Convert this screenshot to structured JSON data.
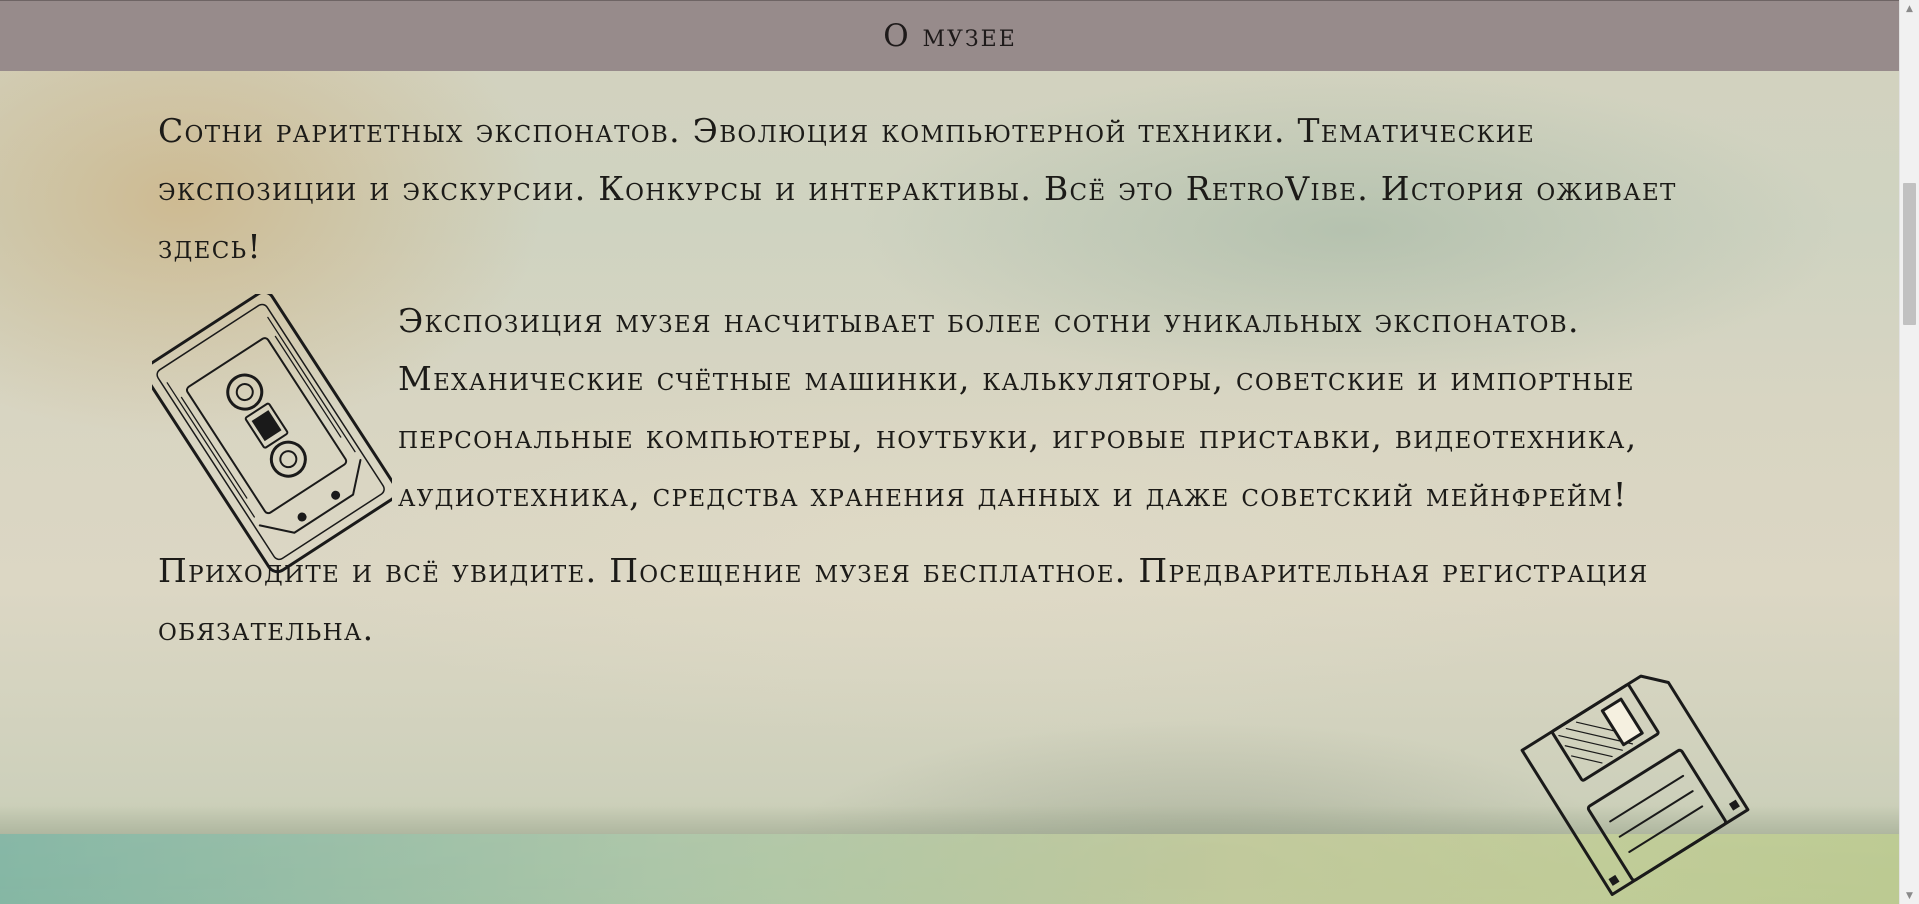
{
  "header": {
    "title": "О музее"
  },
  "content": {
    "intro": "Сотни раритетных экспонатов. Эволюция компьютерной техники. Тематические экспозиции и экскурсии. Конкурсы и интерактивы. Всё это RetroVibe. История оживает здесь!",
    "exhibition": "Экспозиция музея насчитывает более сотни уникальных экспонатов. Механические счётные машинки, калькуляторы, советские и импортные персональные компьютеры, ноутбуки, игровые приставки, видеотехника, аудиотехника, средства хранения данных и даже советский мейнфрейм!",
    "visit": "Приходите и всё увидите. Посещение музея бесплатное. Предварительная регистрация обязательна."
  },
  "icons": [
    "cassette-icon",
    "floppy-disk-icon"
  ],
  "scrollbar": {
    "up_glyph": "▲",
    "down_glyph": "▼",
    "position": 0.2
  }
}
